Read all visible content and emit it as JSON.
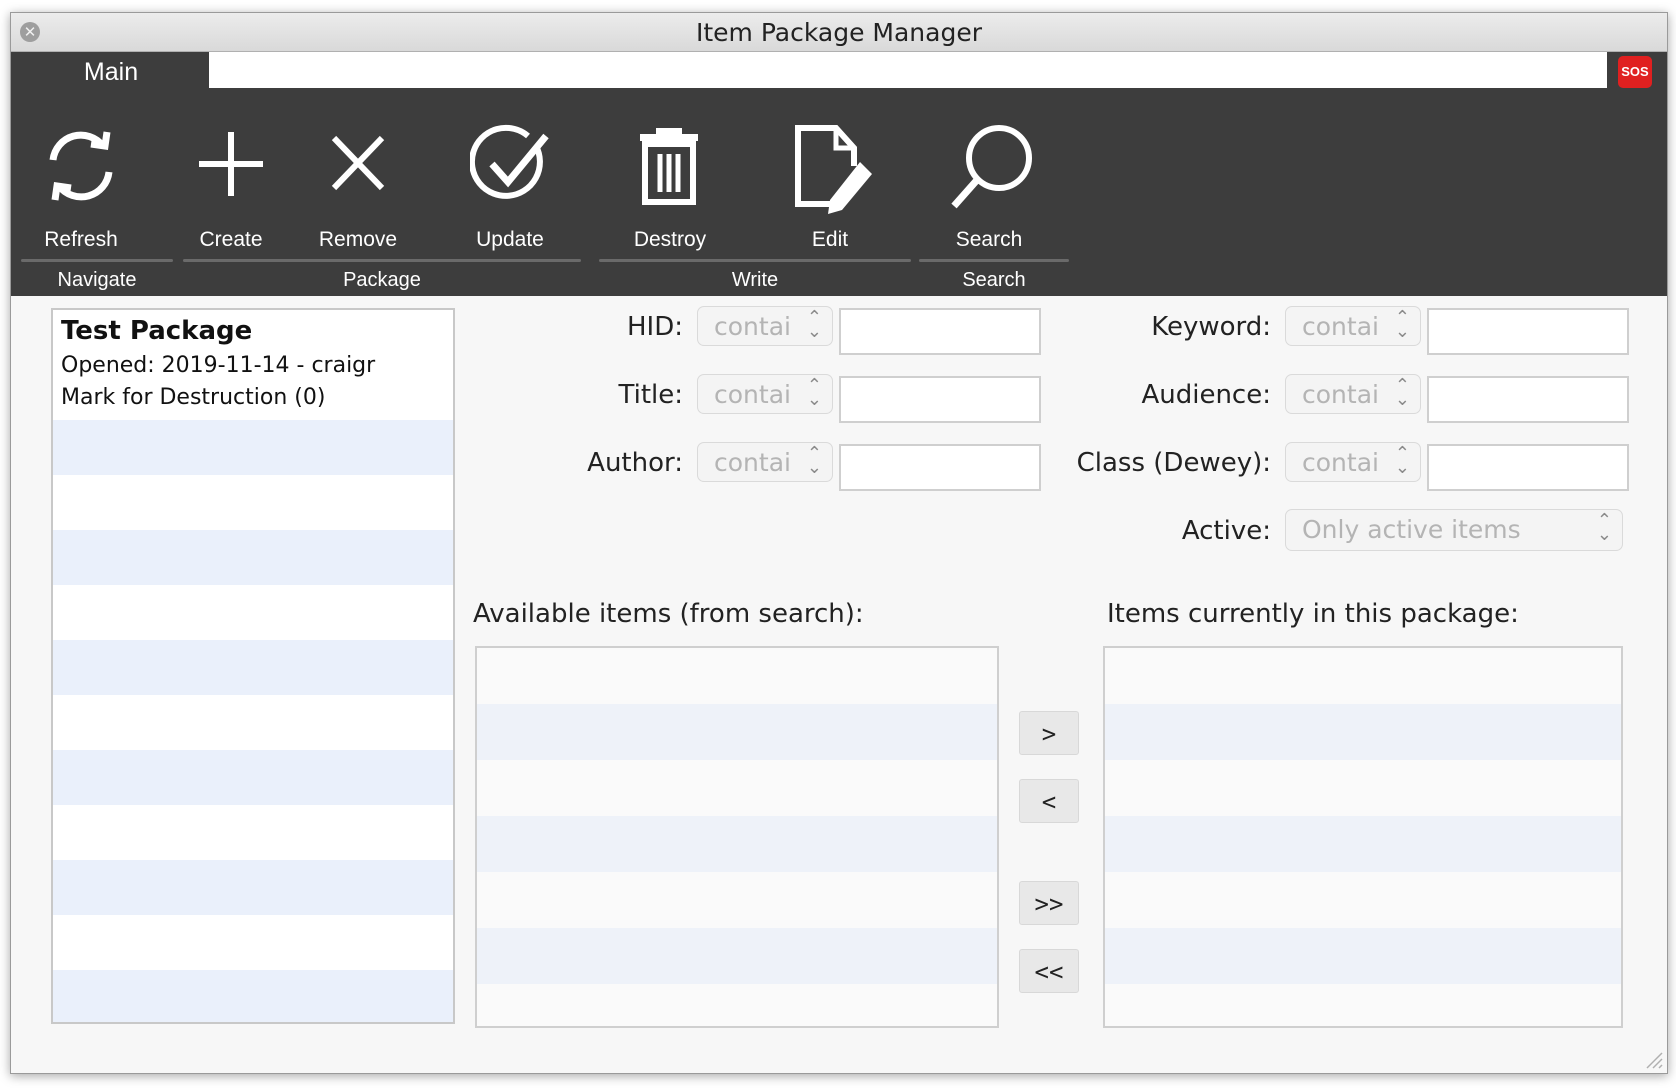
{
  "window": {
    "title": "Item Package Manager",
    "close_glyph": "✕"
  },
  "tabs": {
    "main": "Main",
    "sos": "SOS"
  },
  "toolbar": {
    "refresh": "Refresh",
    "create": "Create",
    "remove": "Remove",
    "update": "Update",
    "destroy": "Destroy",
    "edit": "Edit",
    "search": "Search"
  },
  "groups": {
    "navigate": "Navigate",
    "package": "Package",
    "write": "Write",
    "search": "Search"
  },
  "package_list": {
    "name": "Test Package",
    "opened": "Opened: 2019-11-14 - craigr",
    "mark": "Mark for Destruction (0)"
  },
  "fields": {
    "hid": {
      "label": "HID:",
      "mode": "contai",
      "value": ""
    },
    "title": {
      "label": "Title:",
      "mode": "contai",
      "value": ""
    },
    "author": {
      "label": "Author:",
      "mode": "contai",
      "value": ""
    },
    "keyword": {
      "label": "Keyword:",
      "mode": "contai",
      "value": ""
    },
    "audience": {
      "label": "Audience:",
      "mode": "contai",
      "value": ""
    },
    "class_dewey": {
      "label": "Class (Dewey):",
      "mode": "contai",
      "value": ""
    },
    "active": {
      "label": "Active:",
      "value": "Only active items"
    }
  },
  "lists": {
    "available_title": "Available items (from search):",
    "current_title": "Items currently in this package:"
  },
  "move_buttons": {
    "add_one": ">",
    "remove_one": "<",
    "add_all": ">>",
    "remove_all": "<<"
  },
  "select_arrow": "⌃\n⌄",
  "colors": {
    "toolbar_bg": "#3d3d3d",
    "sos_red": "#e02020",
    "row_alt": "#eaf0fb"
  }
}
